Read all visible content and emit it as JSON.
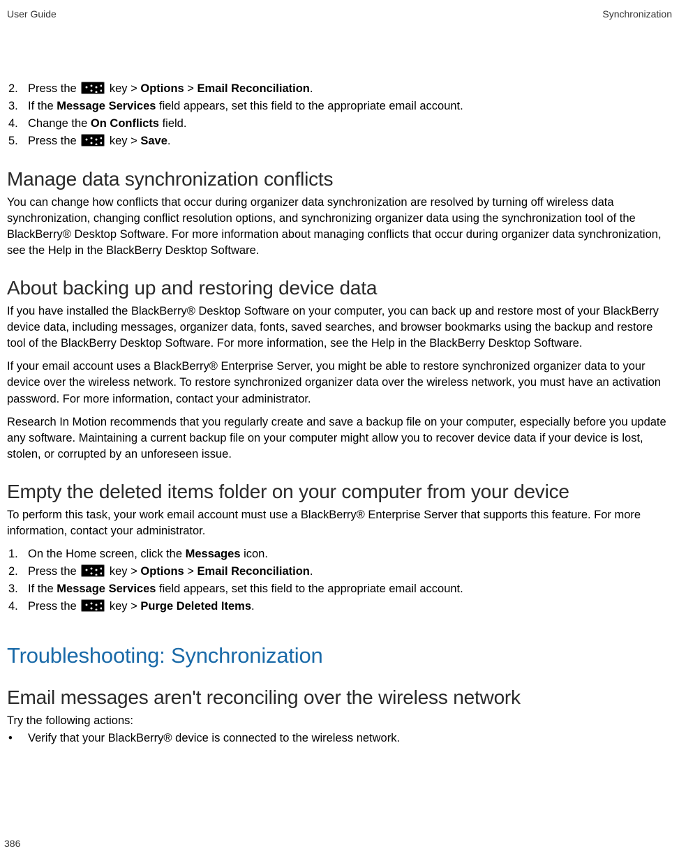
{
  "header": {
    "left": "User Guide",
    "right": "Synchronization"
  },
  "footer": {
    "page": "386"
  },
  "list1": {
    "items": [
      {
        "num": "2.",
        "pre": "Press the ",
        "post": " key > ",
        "b1": "Options",
        "mid": " > ",
        "b2": "Email Reconciliation",
        "end": "."
      },
      {
        "num": "3.",
        "t1": "If the ",
        "b1": "Message Services",
        "t2": " field appears, set this field to the appropriate email account."
      },
      {
        "num": "4.",
        "t1": "Change the ",
        "b1": "On Conflicts",
        "t2": " field."
      },
      {
        "num": "5.",
        "pre": "Press the ",
        "post": " key > ",
        "b1": "Save",
        "end": "."
      }
    ]
  },
  "sec1": {
    "title": "Manage data synchronization conflicts",
    "p1": "You can change how conflicts that occur during organizer data synchronization are resolved by turning off wireless data synchronization, changing conflict resolution options, and synchronizing organizer data using the synchronization tool of the BlackBerry® Desktop Software. For more information about managing conflicts that occur during organizer data synchronization, see the Help in the BlackBerry Desktop Software."
  },
  "sec2": {
    "title": "About backing up and restoring device data",
    "p1": "If you have installed the BlackBerry® Desktop Software on your computer, you can back up and restore most of your BlackBerry device data, including messages, organizer data, fonts, saved searches, and browser bookmarks using the backup and restore tool of the BlackBerry Desktop Software. For more information, see the Help in the BlackBerry Desktop Software.",
    "p2": "If your email account uses a BlackBerry® Enterprise Server, you might be able to restore synchronized organizer data to your device over the wireless network. To restore synchronized organizer data over the wireless network, you must have an activation password. For more information, contact your administrator.",
    "p3": "Research In Motion recommends that you regularly create and save a backup file on your computer, especially before you update any software. Maintaining a current backup file on your computer might allow you to recover device data if your device is lost, stolen, or corrupted by an unforeseen issue."
  },
  "sec3": {
    "title": "Empty the deleted items folder on your computer from your device",
    "p1": "To perform this task, your work email account must use a BlackBerry® Enterprise Server that supports this feature. For more information, contact your administrator.",
    "items": [
      {
        "num": "1.",
        "t1": "On the Home screen, click the ",
        "b1": "Messages",
        "t2": " icon."
      },
      {
        "num": "2.",
        "pre": "Press the ",
        "post": " key > ",
        "b1": "Options",
        "mid": " > ",
        "b2": "Email Reconciliation",
        "end": "."
      },
      {
        "num": "3.",
        "t1": "If the ",
        "b1": "Message Services",
        "t2": " field appears, set this field to the appropriate email account."
      },
      {
        "num": "4.",
        "pre": "Press the ",
        "post": " key > ",
        "b1": "Purge Deleted Items",
        "end": "."
      }
    ]
  },
  "major": {
    "title": "Troubleshooting: Synchronization"
  },
  "sec4": {
    "title": "Email messages aren't reconciling over the wireless network",
    "p1": "Try the following actions:",
    "bullets": [
      {
        "dot": "•",
        "text": "Verify that your BlackBerry® device is connected to the wireless network."
      }
    ]
  }
}
